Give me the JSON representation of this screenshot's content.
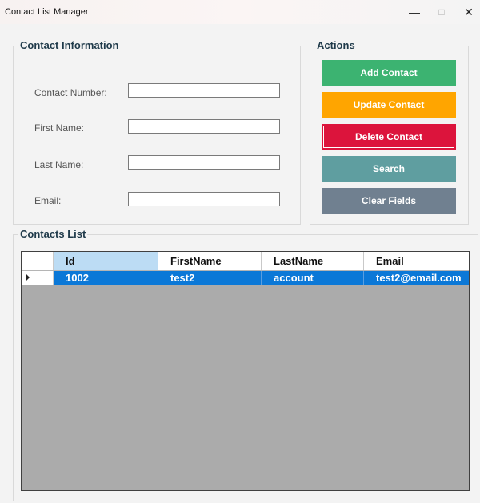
{
  "window": {
    "title": "Contact List Manager",
    "minimize_glyph": "—",
    "maximize_glyph": "□",
    "close_glyph": "✕"
  },
  "contact_info": {
    "title": "Contact Information",
    "fields": [
      {
        "label": "Contact Number:",
        "value": ""
      },
      {
        "label": "First Name:",
        "value": ""
      },
      {
        "label": "Last Name:",
        "value": ""
      },
      {
        "label": "Email:",
        "value": ""
      }
    ]
  },
  "actions": {
    "title": "Actions",
    "buttons": [
      {
        "label": "Add Contact",
        "color": "#3cb371"
      },
      {
        "label": "Update Contact",
        "color": "#ffa500"
      },
      {
        "label": "Delete Contact",
        "color": "#dc143c"
      },
      {
        "label": "Search",
        "color": "#5f9ea0"
      },
      {
        "label": "Clear Fields",
        "color": "#708090"
      }
    ]
  },
  "contacts_list": {
    "title": "Contacts List",
    "columns": [
      "Id",
      "FirstName",
      "LastName",
      "Email"
    ],
    "rows": [
      [
        "1002",
        "test2",
        "account",
        "test2@email.com"
      ]
    ],
    "selection_color": "#0b78d7",
    "empty_area_color": "#ababab"
  }
}
